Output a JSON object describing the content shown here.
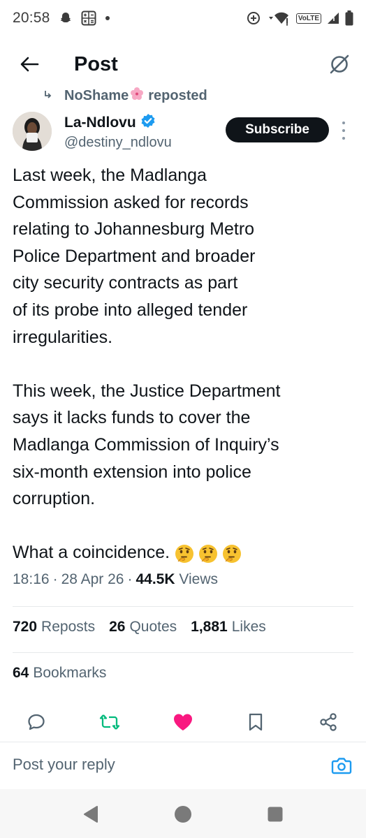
{
  "status_bar": {
    "time": "20:58",
    "volte": "VoLTE"
  },
  "header": {
    "title": "Post"
  },
  "repost": {
    "by": "NoShame",
    "label": "reposted"
  },
  "author": {
    "name": "La-Ndlovu",
    "handle": "@destiny_ndlovu",
    "subscribe_label": "Subscribe",
    "verified_color": "#1d9bf0"
  },
  "post": {
    "paragraph_1": "Last week, the Madlanga\nCommission asked for records\nrelating to Johannesburg Metro\nPolice Department and broader\ncity security contracts as part\nof its probe into alleged tender\nirregularities.",
    "paragraph_2": "This week, the Justice Department\nsays it lacks funds to cover the\nMadlanga Commission of Inquiry’s\nsix-month extension into police\ncorruption.",
    "paragraph_3": "What a coincidence.",
    "emojis": [
      "thinking-face-emoji",
      "thinking-face-emoji",
      "thinking-face-emoji"
    ]
  },
  "meta": {
    "time": "18:16",
    "date": "28 Apr 26",
    "views_count": "44.5K",
    "views_label": "Views",
    "separator": "·"
  },
  "stats": {
    "reposts_count": "720",
    "reposts_label": "Reposts",
    "quotes_count": "26",
    "quotes_label": "Quotes",
    "likes_count": "1,881",
    "likes_label": "Likes",
    "bookmarks_count": "64",
    "bookmarks_label": "Bookmarks"
  },
  "actions": {
    "icons": [
      "reply-icon",
      "repost-icon",
      "like-icon",
      "bookmark-icon",
      "share-icon"
    ],
    "repost_color": "#00ba7c",
    "like_color": "#f91880"
  },
  "reply": {
    "placeholder": "Post your reply"
  },
  "colors": {
    "text": "#0f1419",
    "secondary": "#536471",
    "accent": "#1d9bf0"
  }
}
